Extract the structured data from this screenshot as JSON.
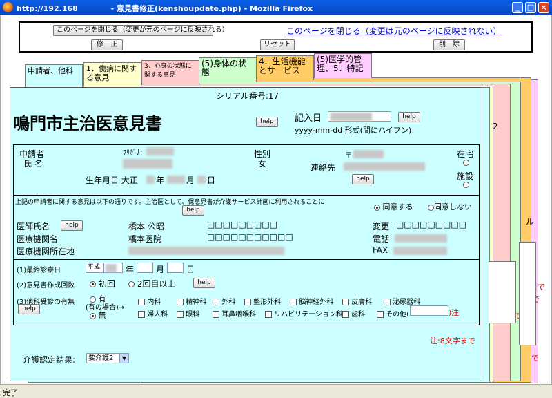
{
  "window": {
    "title": "http://192.168　　　　 - 意見書修正(kenshoupdate.php) - Mozilla Firefox",
    "min": "_",
    "max": "□",
    "close": "×"
  },
  "top": {
    "close_reflect": "このページを閉じる（変更が元のページに反映される）",
    "close_noreflect": "このページを閉じる（変更は元のページに反映されない）",
    "fix": "修　正",
    "reset": "リセット",
    "delete": "削　除"
  },
  "tabs": [
    {
      "label": "申請者、他科",
      "color": "#ccffff"
    },
    {
      "label": "1．傷病に関する意見",
      "color": "#ffffcc"
    },
    {
      "label": "3．心身の状態に関する意見",
      "color": "#ffcccc"
    },
    {
      "label": "(5)身体の状態",
      "color": "#ccffcc"
    },
    {
      "label": "4．生活機能とサービス",
      "color": "#ffcc66"
    },
    {
      "label": "(5)医学的管理、5．特記",
      "color": "#ffccff"
    }
  ],
  "stack": {
    "back1": "2",
    "back2": "ル",
    "back3": "まで",
    "back4": "まで",
    "back5": "で",
    "back6": "で",
    "back7": "で"
  },
  "form": {
    "serial_label": "シリアル番号:17",
    "title": "鳴門市主治医意見書",
    "help": "help",
    "date_label": "記入日",
    "date_format": "yyyy-mm-dd 形式(間にハイフン)",
    "applicant_label_1": "申請者",
    "applicant_label_2": "氏 名",
    "furigana": "ﾌﾘｶﾞﾅ:",
    "sex_label": "性別",
    "sex_value": "女",
    "postal": "〒",
    "contact_label": "連絡先",
    "home": "在宅",
    "facility": "施設",
    "birth_label": "生年月日 大正",
    "year": "年",
    "month": "月",
    "day": "日",
    "consent_text": "上記の申請者に関する意見は以下の通りです。主治医として、保意見書が介護サービス計画に利用されることに",
    "consent_yes": "同意する",
    "consent_no": "同意しない",
    "doctor_label": "医師氏名",
    "doctor_name": "橋本 公昭",
    "doctor_boxes": "□□□□□□□□□",
    "change_label": "変更",
    "change_boxes": "□□□□□□□□□",
    "inst_label": "医療機関名",
    "inst_name": "橋本医院",
    "inst_boxes": "□□□□□□□□□□□",
    "tel_label": "電話",
    "addr_label": "医療機関所在地",
    "fax_label": "FAX",
    "q1": "(1)最終診察日",
    "era": "平成",
    "q2": "(2)意見書作成回数",
    "q2_first": "初回",
    "q2_second": "2回目以上",
    "q3": "(3)他科受診の有無",
    "q3_yes": "有",
    "q3_case": "(有の場合)→",
    "q3_no": "無",
    "depts_row1": [
      "内科",
      "精神科",
      "外科",
      "整形外科",
      "脳神経外科",
      "皮膚科",
      "泌尿器科"
    ],
    "depts_row2": [
      "婦人科",
      "眼科",
      "耳鼻咽喉科",
      "リハビリテーション科",
      "歯科",
      "その他("
    ],
    "note_paren": ")注",
    "note": "注:8文字まで",
    "care_label": "介護認定結果:",
    "care_value": "要介護2"
  },
  "status": "完了"
}
